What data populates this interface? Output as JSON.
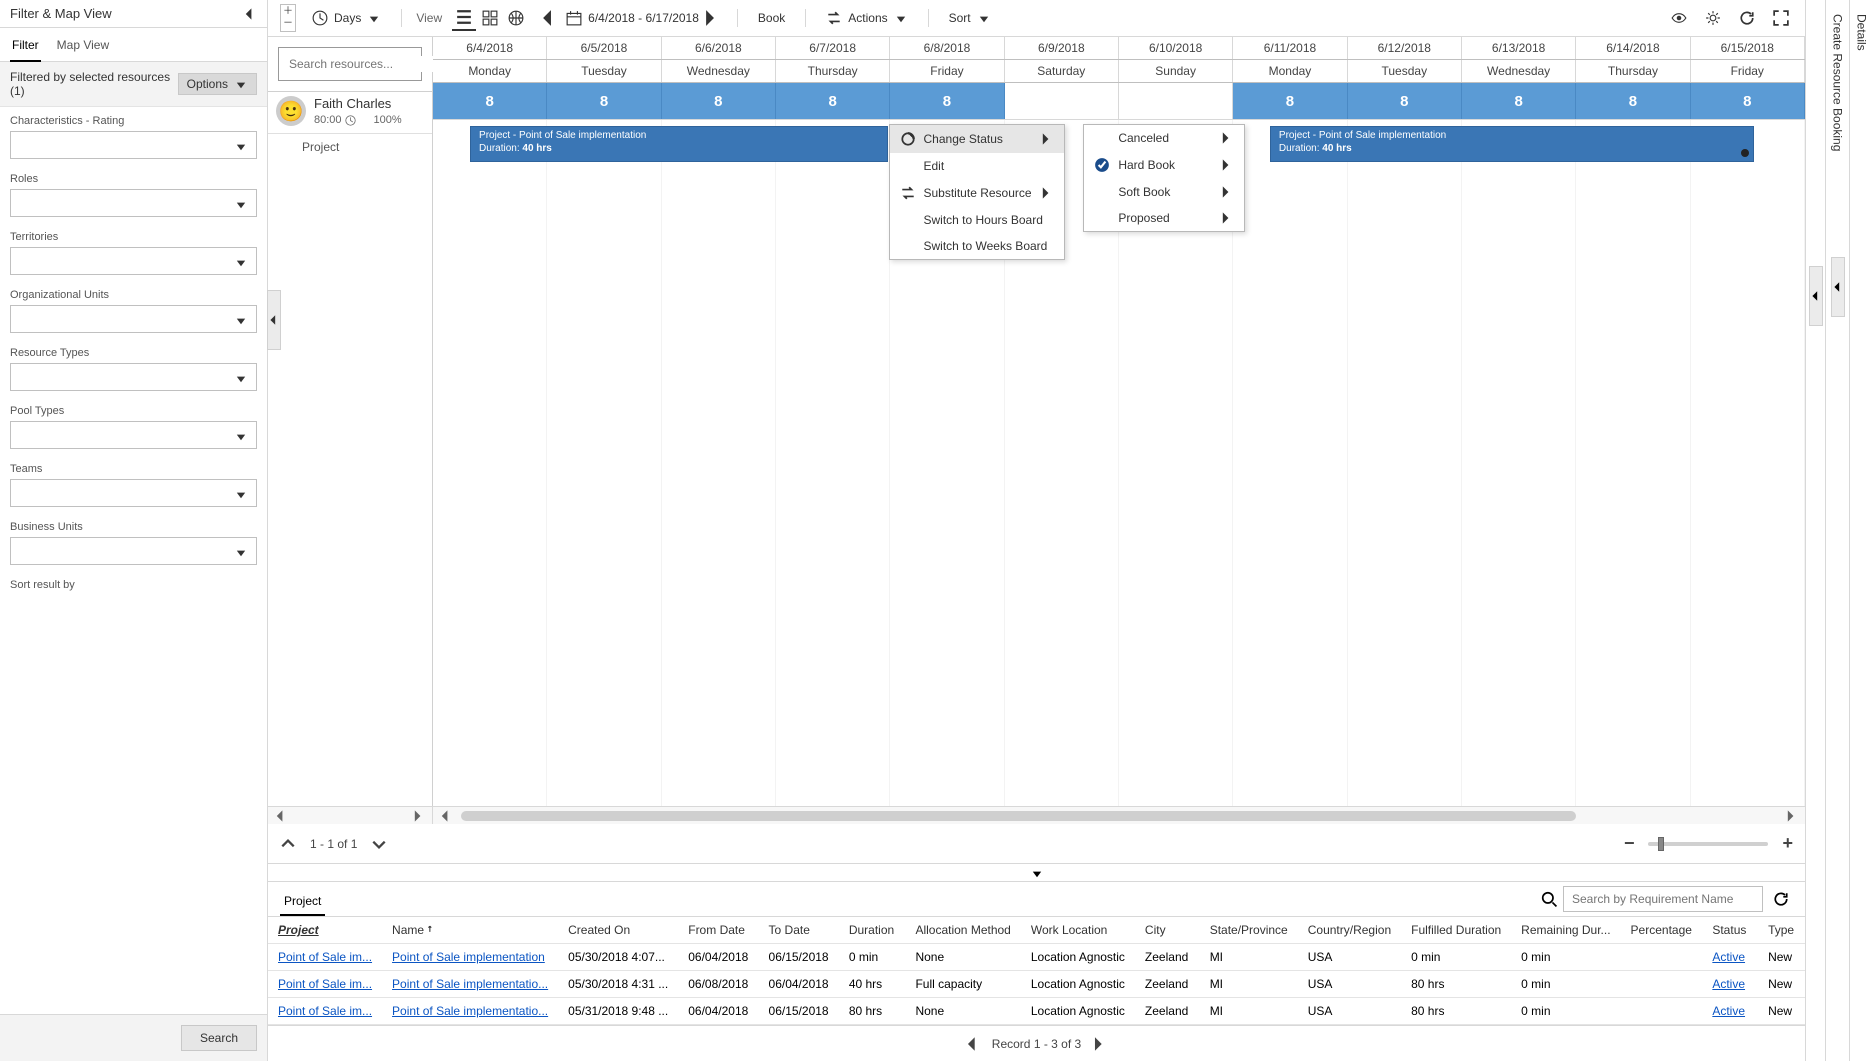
{
  "sidebar": {
    "title": "Filter & Map View",
    "tabs": [
      "Filter",
      "Map View"
    ],
    "activeTab": 0,
    "summary": "Filtered by selected resources (1)",
    "optionsLabel": "Options",
    "searchLabel": "Search",
    "groups": [
      {
        "label": "Characteristics - Rating"
      },
      {
        "label": "Roles"
      },
      {
        "label": "Territories"
      },
      {
        "label": "Organizational Units"
      },
      {
        "label": "Resource Types"
      },
      {
        "label": "Pool Types"
      },
      {
        "label": "Teams"
      },
      {
        "label": "Business Units"
      },
      {
        "label": "Sort result by"
      }
    ]
  },
  "toolbar": {
    "scaleLabel": "Days",
    "viewLabel": "View",
    "dateRange": "6/4/2018 - 6/17/2018",
    "bookLabel": "Book",
    "actionsLabel": "Actions",
    "sortLabel": "Sort"
  },
  "resourceSearchPh": "Search resources...",
  "resource": {
    "name": "Faith Charles",
    "hours": "80:00",
    "pct": "100%",
    "group": "Project"
  },
  "timeline": {
    "dates": [
      "6/4/2018",
      "6/5/2018",
      "6/6/2018",
      "6/7/2018",
      "6/8/2018",
      "6/9/2018",
      "6/10/2018",
      "6/11/2018",
      "6/12/2018",
      "6/13/2018",
      "6/14/2018",
      "6/15/2018"
    ],
    "days": [
      "Monday",
      "Tuesday",
      "Wednesday",
      "Thursday",
      "Friday",
      "Saturday",
      "Sunday",
      "Monday",
      "Tuesday",
      "Wednesday",
      "Thursday",
      "Friday"
    ],
    "alloc": [
      "8",
      "8",
      "8",
      "8",
      "8",
      "",
      "",
      "8",
      "8",
      "8",
      "8",
      "8"
    ]
  },
  "bookings": [
    {
      "title": "Project - Point of Sale implementation",
      "durLabel": "Duration:",
      "dur": "40 hrs"
    },
    {
      "title": "Project - Point of Sale implementation",
      "durLabel": "Duration:",
      "dur": "40 hrs"
    }
  ],
  "ctx1": {
    "changeStatus": "Change Status",
    "edit": "Edit",
    "substitute": "Substitute Resource",
    "hoursBoard": "Switch to Hours Board",
    "weeksBoard": "Switch to Weeks Board"
  },
  "ctx2": {
    "canceled": "Canceled",
    "hardBook": "Hard Book",
    "softBook": "Soft Book",
    "proposed": "Proposed"
  },
  "paging": {
    "text": "1 - 1 of 1"
  },
  "bottom": {
    "tab": "Project",
    "searchPh": "Search by Requirement Name",
    "headers": [
      "Project",
      "Name",
      "Created On",
      "From Date",
      "To Date",
      "Duration",
      "Allocation Method",
      "Work Location",
      "City",
      "State/Province",
      "Country/Region",
      "Fulfilled Duration",
      "Remaining Dur...",
      "Percentage",
      "Status",
      "Type"
    ],
    "rows": [
      {
        "project": "Point of Sale im...",
        "name": "Point of Sale implementation",
        "createdOn": "05/30/2018 4:07...",
        "from": "06/04/2018",
        "to": "06/15/2018",
        "duration": "0 min",
        "alloc": "None",
        "workLoc": "Location Agnostic",
        "city": "Zeeland",
        "state": "MI",
        "country": "USA",
        "fulfilled": "0 min",
        "remaining": "0 min",
        "pct": "",
        "status": "Active",
        "type": "New"
      },
      {
        "project": "Point of Sale im...",
        "name": "Point of Sale implementatio...",
        "createdOn": "05/30/2018 4:31 ...",
        "from": "06/08/2018",
        "to": "06/04/2018",
        "duration": "40 hrs",
        "alloc": "Full capacity",
        "workLoc": "Location Agnostic",
        "city": "Zeeland",
        "state": "MI",
        "country": "USA",
        "fulfilled": "80 hrs",
        "remaining": "0 min",
        "pct": "",
        "status": "Active",
        "type": "New"
      },
      {
        "project": "Point of Sale im...",
        "name": "Point of Sale implementatio...",
        "createdOn": "05/31/2018 9:48 ...",
        "from": "06/04/2018",
        "to": "06/15/2018",
        "duration": "80 hrs",
        "alloc": "None",
        "workLoc": "Location Agnostic",
        "city": "Zeeland",
        "state": "MI",
        "country": "USA",
        "fulfilled": "80 hrs",
        "remaining": "0 min",
        "pct": "",
        "status": "Active",
        "type": "New"
      }
    ],
    "footer": "Record 1 - 3 of 3"
  },
  "rails": {
    "createBooking": "Create Resource Booking",
    "details": "Details"
  }
}
